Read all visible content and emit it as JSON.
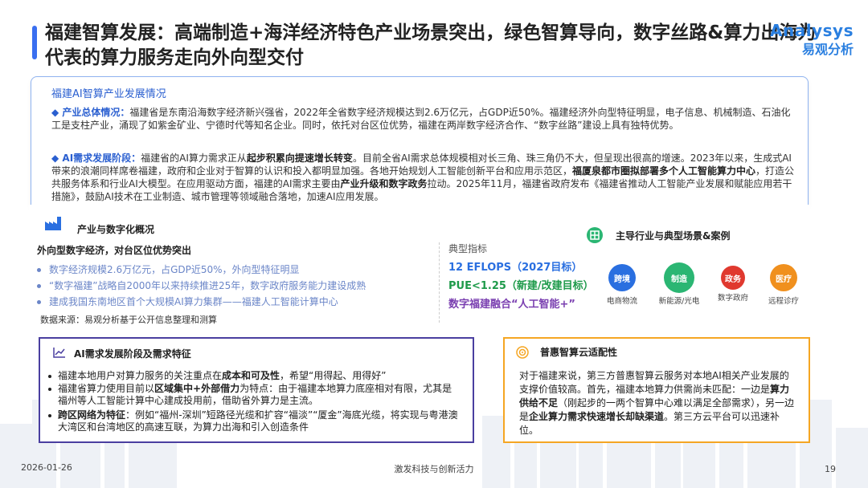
{
  "title": "福建智算发展：高端制造+海洋经济特色产业场景突出，绿色智算导向，数字丝路&算力出海为代表的算力服务走向外向型交付",
  "logo": {
    "en": "Analysys",
    "cn": "易观分析"
  },
  "overview": {
    "title": "福建AI智算产业发展情况",
    "p1_head": "◆ 产业总体情况：",
    "p1": "福建省是东南沿海数字经济新兴强省，2022年全省数字经济规模达到2.6万亿元，占GDP近50%。福建经济外向型特征明显，电子信息、机械制造、石油化工是支柱产业，涌现了如紫金矿业、宁德时代等知名企业。同时，依托对台区位优势，福建在两岸数字经济合作、“数字丝路”建设上具有独特优势。",
    "p2_head": "◆ AI需求发展阶段：",
    "p2_a": "福建省的AI算力需求正从",
    "p2_b": "起步积累向提速增长转变",
    "p2_c": "。目前全省AI需求总体规模相对长三角、珠三角仍不大，但呈现出很高的增速。2023年以来，生成式AI带来的浪潮同样席卷福建，政府和企业对于智算的认识和投入都明显加强。各地开始规划人工智能创新平台和应用示范区，",
    "p2_d": "福厦泉都市圈拟部署多个人工智能算力中心",
    "p2_e": "，打造公共服务体系和行业AI大模型。在应用驱动方面，福建的AI需求主要由",
    "p2_f": "产业升级和数字政务",
    "p2_g": "拉动。2025年11月，福建省政府发布《福建省推动人工智能产业发展和赋能应用若干措施》，鼓励AI技术在工业制造、城市管理等领域融合落地，加速AI应用发展。"
  },
  "industry": {
    "heading": "产业与数字化概况",
    "left_heading": "外向型数字经济，对台区位优势突出",
    "bullets": [
      "数字经济规模2.6万亿元，占GDP近50%，外向型特征明显",
      "“数字福建”战略自2000年以来持续推进25年，数字政府服务能力建设成熟",
      "建成我国东南地区首个大规模AI算力集群——福建人工智能计算中心"
    ],
    "source": "数据来源：易观分析基于公开信息整理和测算",
    "indicators_heading": "典型指标",
    "indicators": [
      "12 EFLOPS（2027目标）",
      "PUE<1.25（新建/改建目标）",
      "数字福建融合“人工智能+”"
    ],
    "colors": {
      "ind1": "#2a6fe0",
      "ind2": "#1e9a4a",
      "ind3": "#7a3fb0"
    },
    "right_heading": "主导行业与典型场景&案例",
    "circles": [
      {
        "label": "跨境",
        "sub": "电商物流",
        "color": "#2a6fe0"
      },
      {
        "label": "制造",
        "sub": "新能源/光电",
        "color": "#2bb673"
      },
      {
        "label": "政务",
        "sub": "数字政府",
        "color": "#e0392f"
      },
      {
        "label": "医疗",
        "sub": "远程诊疗",
        "color": "#f0901e"
      }
    ]
  },
  "demand": {
    "heading": "AI需求发展阶段及需求特征",
    "b1_a": "福建本地用户对算力服务的关注重点在",
    "b1_b": "成本和可及性",
    "b1_c": "，希望“用得起、用得好”",
    "b2_a": "福建省算力使用目前以",
    "b2_b": "区域集中+外部借力",
    "b2_c": "为特点：由于福建本地算力底座相对有限，尤其是福州等人工智能计算中心建成投用前，借助省外算力是主流。",
    "b3_a": "跨区网络为特征",
    "b3_b": "：例如“福州-深圳”短路径光缆和扩容“福淡”“厦金”海底光缆，将实现与粤港澳大湾区和台湾地区的高速互联，为算力出海和引入创造条件"
  },
  "cloud": {
    "heading": "普惠智算云适配性",
    "t1": "对于福建来说，第三方普惠智算云服务对本地AI相关产业发展的支撑价值较高。首先，福建本地算力供需尚未匹配：一边是",
    "t2": "算力供给不足",
    "t3": "（刚起步的一两个智算中心难以满足全部需求），另一边是",
    "t4": "企业算力需求快速增长却缺渠道",
    "t5": "。第三方云平台可以迅速补位。"
  },
  "footer": {
    "date": "2026-01-26",
    "center": "激发科技与创新活力",
    "page": "19"
  }
}
